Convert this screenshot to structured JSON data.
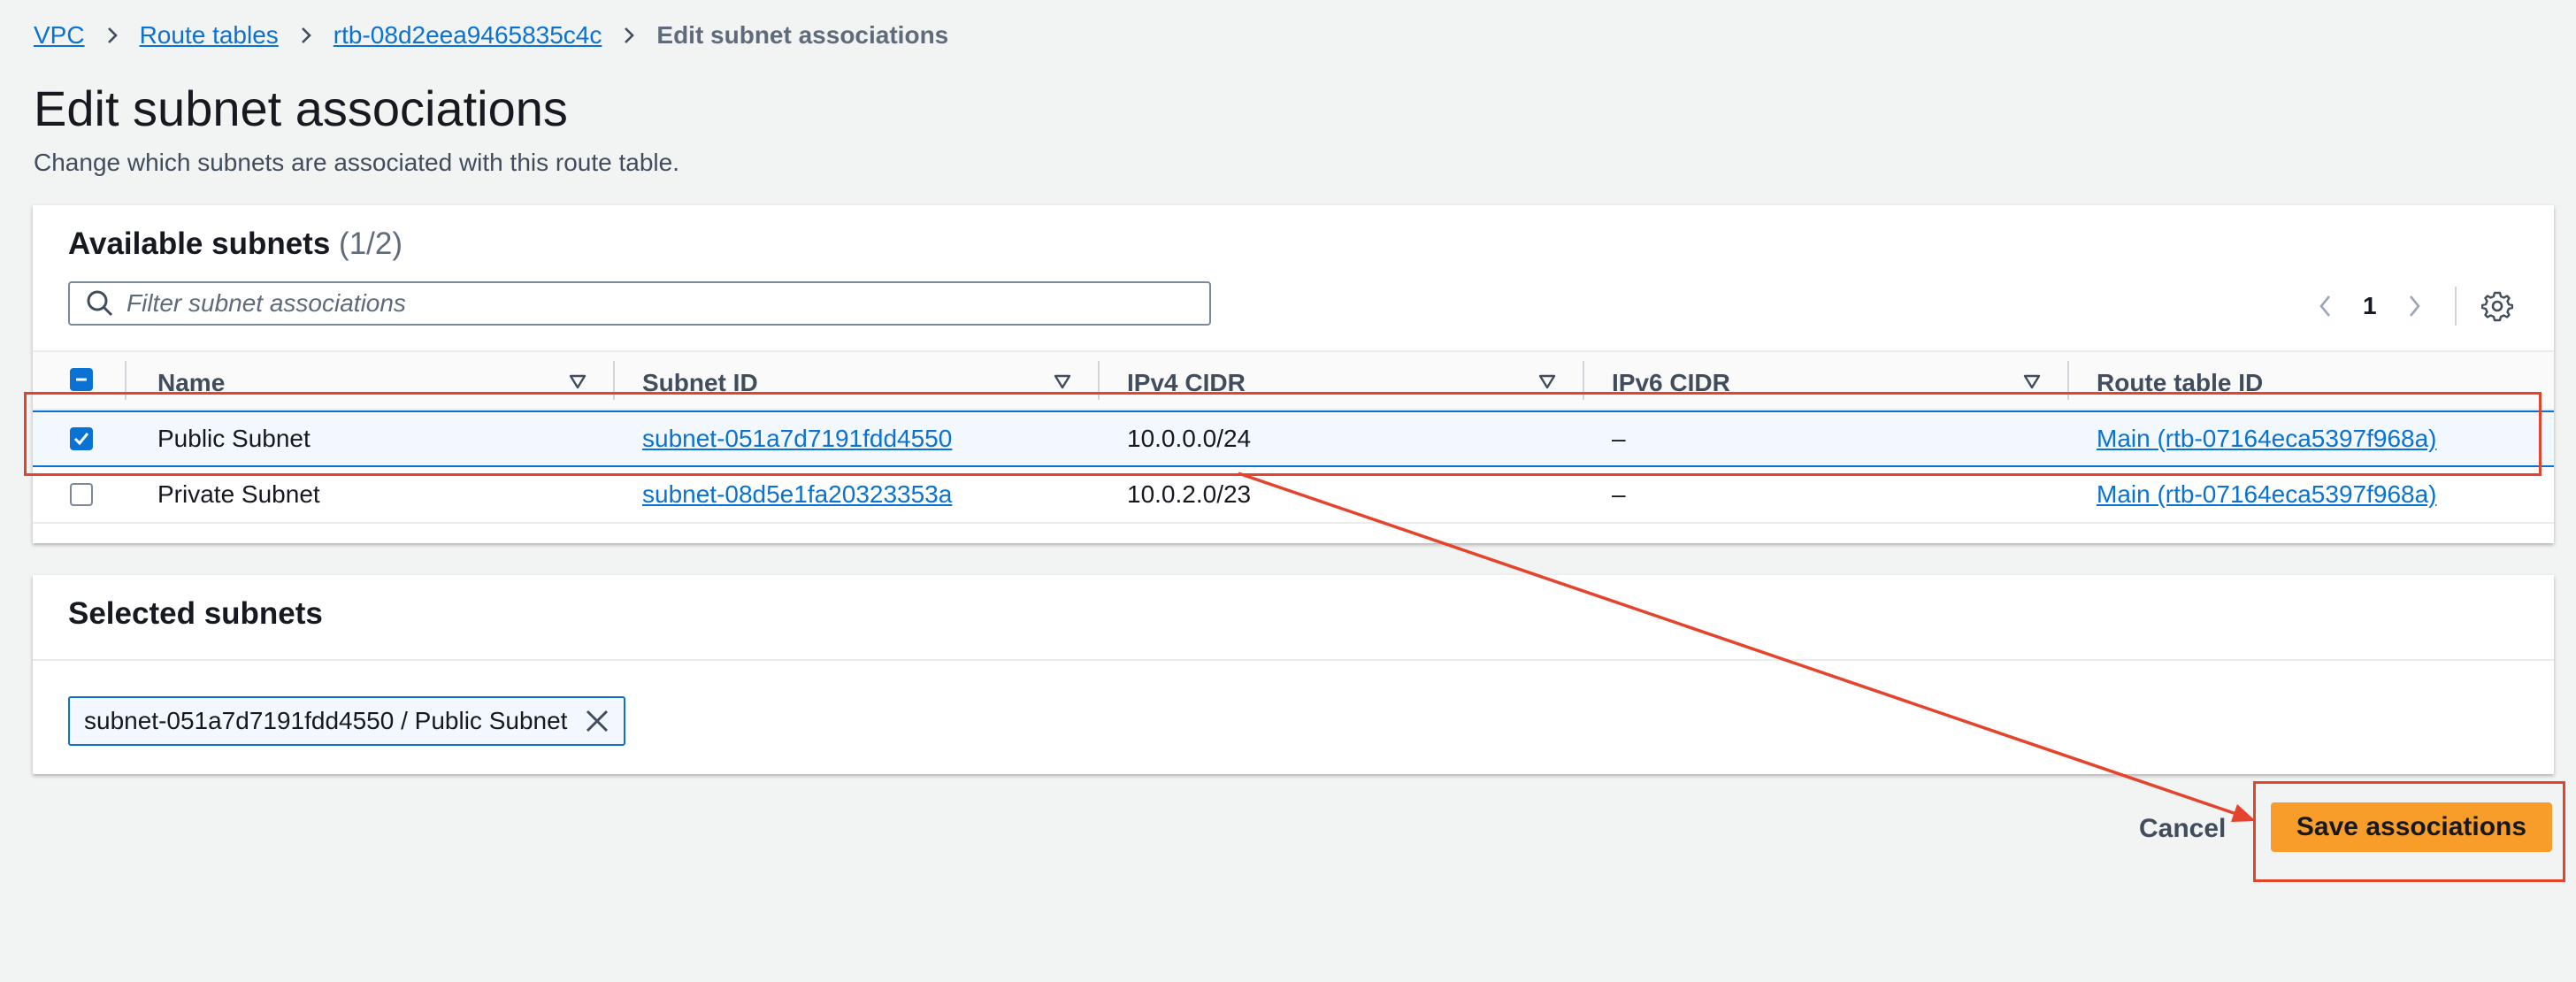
{
  "breadcrumb": {
    "items": [
      "VPC",
      "Route tables",
      "rtb-08d2eea9465835c4c"
    ],
    "current": "Edit subnet associations"
  },
  "page": {
    "title": "Edit subnet associations",
    "description": "Change which subnets are associated with this route table."
  },
  "available": {
    "title": "Available subnets",
    "count": "(1/2)",
    "filter_placeholder": "Filter subnet associations",
    "page_number": "1",
    "columns": [
      "Name",
      "Subnet ID",
      "IPv4 CIDR",
      "IPv6 CIDR",
      "Route table ID"
    ],
    "rows": [
      {
        "checked": true,
        "name": "Public Subnet",
        "subnet_id": "subnet-051a7d7191fdd4550",
        "ipv4": "10.0.0.0/24",
        "ipv6": "–",
        "route_table": "Main (rtb-07164eca5397f968a)"
      },
      {
        "checked": false,
        "name": "Private Subnet",
        "subnet_id": "subnet-08d5e1fa20323353a",
        "ipv4": "10.0.2.0/23",
        "ipv6": "–",
        "route_table": "Main (rtb-07164eca5397f968a)"
      }
    ]
  },
  "selected": {
    "title": "Selected subnets",
    "tokens": [
      "subnet-051a7d7191fdd4550 / Public Subnet"
    ]
  },
  "footer": {
    "cancel_label": "Cancel",
    "save_label": "Save associations"
  },
  "colors": {
    "link": "#0972d3",
    "primary_button": "#f89c2a",
    "annotation": "#e5432b",
    "background": "#f2f3f3"
  },
  "icons": [
    "chevron-right-icon",
    "search-icon",
    "chevron-left-icon",
    "gear-icon",
    "sort-icon",
    "close-icon",
    "checkbox-icon"
  ]
}
